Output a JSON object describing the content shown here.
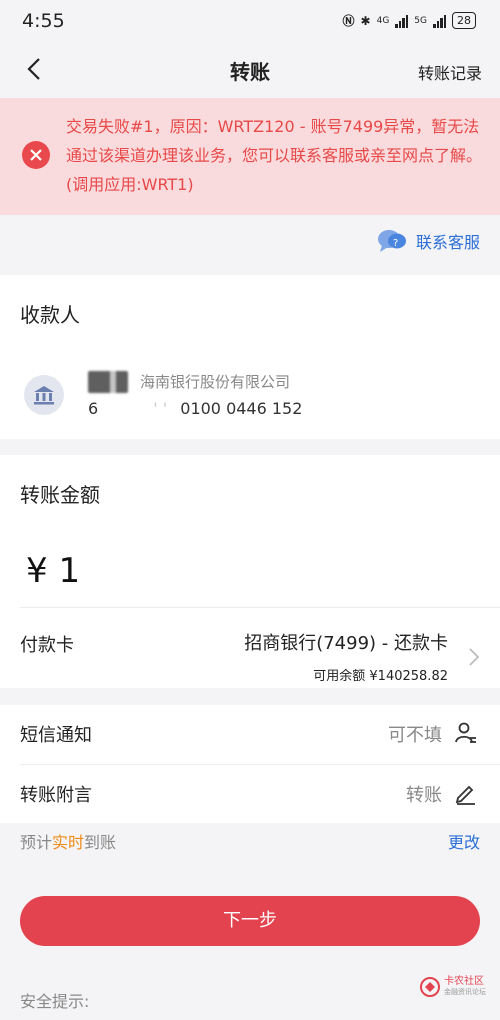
{
  "status": {
    "time": "4:55",
    "battery": "28",
    "net1": "4G",
    "net2": "5G"
  },
  "nav": {
    "title": "转账",
    "right": "转账记录"
  },
  "alert": {
    "text": "交易失败#1，原因：WRTZ120 - 账号7499异常，暂无法通过该渠道办理该业务，您可以联系客服或亲至网点了解。(调用应用:WRT1)"
  },
  "service": {
    "label": "联系客服"
  },
  "payee": {
    "title": "收款人",
    "bank_name": "海南银行股份有限公司",
    "account_prefix": "6",
    "account_mid": "' '",
    "account_suffix": "0100 0446 152"
  },
  "amount": {
    "title": "转账金额",
    "value": "¥ 1",
    "pay_label": "付款卡",
    "pay_card": "招商银行(7499) - 还款卡",
    "balance": "可用余额 ¥140258.82"
  },
  "sms": {
    "label": "短信通知",
    "value": "可不填"
  },
  "memo": {
    "label": "转账附言",
    "value": "转账"
  },
  "eta": {
    "prefix": "预计",
    "highlight": "实时",
    "suffix": "到账",
    "change": "更改"
  },
  "next_button": "下一步",
  "tips": {
    "label": "安全提示:"
  },
  "watermark": {
    "line1": "卡农社区",
    "line2": "金融资讯论坛"
  },
  "colors": {
    "accent": "#e3434f",
    "link": "#2b6fd6",
    "alert_bg": "#fadbdd",
    "alert_text": "#e74848",
    "highlight": "#f08a18"
  }
}
